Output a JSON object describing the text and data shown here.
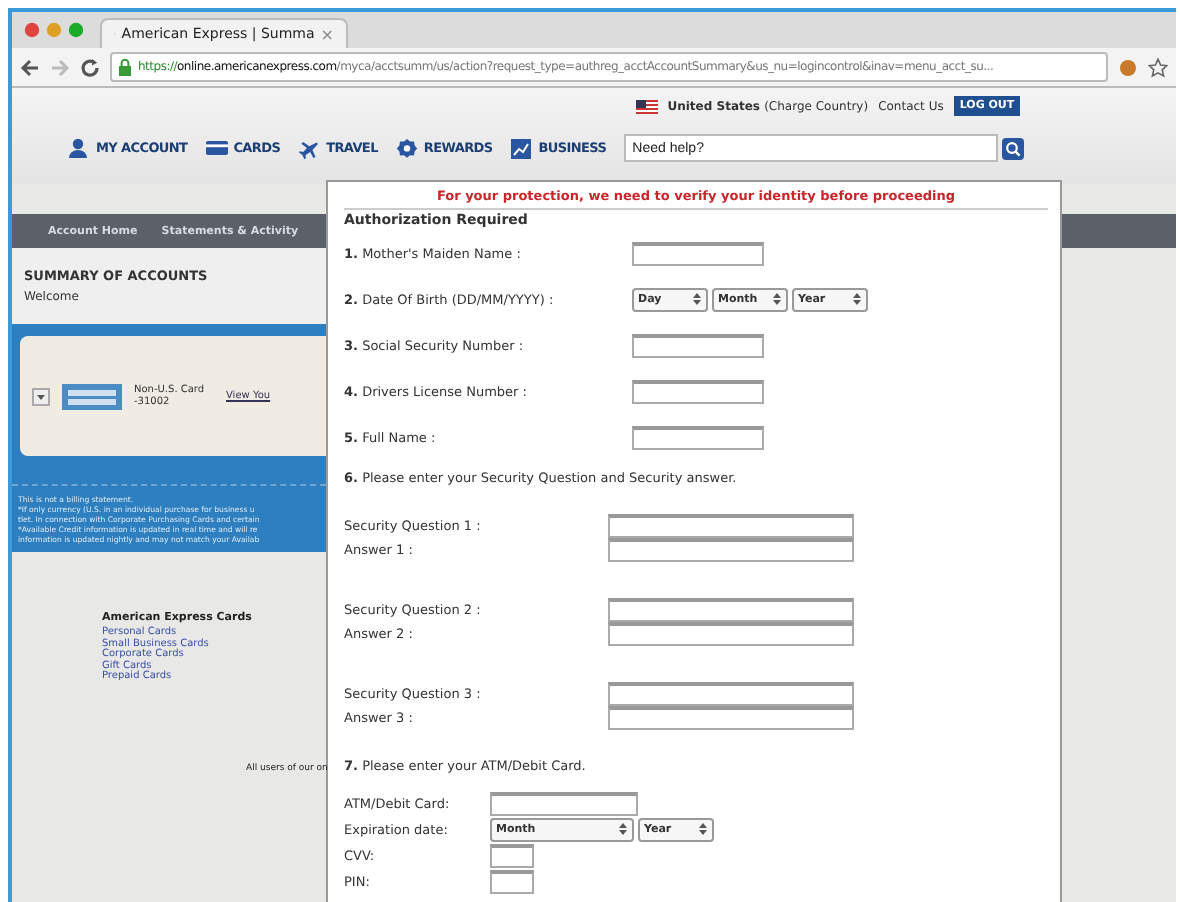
{
  "browser": {
    "tab_title": "American Express | Summa",
    "tab_close": "×",
    "url_scheme": "https://",
    "url_host": "online.americanexpress.com",
    "url_path": "/myca/acctsumm/us/action?request_type=authreg_acctAccountSummary&us_nu=logincontrol&inav=menu_acct_su..."
  },
  "header": {
    "country": "United States",
    "country_note": "(Charge Country)",
    "contact": "Contact Us",
    "logout": "LOG OUT",
    "search_placeholder": "Need help?",
    "nav": [
      {
        "label": "MY ACCOUNT",
        "kind": "person"
      },
      {
        "label": "CARDS",
        "kind": "card"
      },
      {
        "label": "TRAVEL",
        "kind": "plane"
      },
      {
        "label": "REWARDS",
        "kind": "badge"
      },
      {
        "label": "BUSINESS",
        "kind": "chart"
      }
    ]
  },
  "account": {
    "subnav": [
      "Account Home",
      "Statements & Activity"
    ],
    "title": "SUMMARY OF ACCOUNTS",
    "welcome": "Welcome",
    "card_name": "Non-U.S. Card",
    "card_number": "-31002",
    "card_link": "View You",
    "notes": [
      "This is not a billing statement.",
      "*If only currency (U.S. in an individual purchase for business u",
      "tlet. In connection with Corporate Purchasing Cards and certain",
      "*Available Credit information is updated in real time and will re",
      "information is updated nightly and may not match your Availab"
    ]
  },
  "footer": {
    "title": "American Express Cards",
    "links": [
      "Personal Cards",
      "Small Business Cards",
      "Corporate Cards",
      "Gift Cards",
      "Prepaid Cards"
    ],
    "note": "All users of our on"
  },
  "modal": {
    "banner": "For your protection, we need to verify your identity before proceeding",
    "title": "Authorization Required",
    "rows": [
      {
        "kind": "text",
        "number": "1.",
        "label": "Mother's Maiden Name :"
      },
      {
        "kind": "select",
        "number": "2.",
        "label": "Date Of Birth (DD/MM/YYYY) :",
        "options": [
          "Day",
          "Month",
          "Year"
        ]
      },
      {
        "kind": "text",
        "number": "3.",
        "label": "Social Security Number :"
      },
      {
        "kind": "text",
        "number": "4.",
        "label": "Drivers License Number :"
      },
      {
        "kind": "text",
        "number": "5.",
        "label": "Full Name :"
      },
      {
        "kind": "heading",
        "number": "6.",
        "label": "Please enter your Security Question and Security answer."
      },
      {
        "kind": "question",
        "label": "Security Question 1 :"
      },
      {
        "kind": "answer",
        "label": "Answer 1 :"
      },
      {
        "kind": "question",
        "label": "Security Question 2 :"
      },
      {
        "kind": "answer",
        "label": "Answer 2 :"
      },
      {
        "kind": "question",
        "label": "Security Question 3 :"
      },
      {
        "kind": "answer",
        "label": "Answer 3 :"
      },
      {
        "kind": "heading",
        "number": "7.",
        "label": "Please enter your ATM/Debit Card."
      },
      {
        "kind": "card",
        "label": "ATM/Debit Card:"
      },
      {
        "kind": "card-select",
        "label": "Expiration date:",
        "options": [
          "Month",
          "Year"
        ]
      },
      {
        "kind": "short",
        "label": "CVV:"
      },
      {
        "kind": "short",
        "label": "PIN:"
      }
    ]
  }
}
